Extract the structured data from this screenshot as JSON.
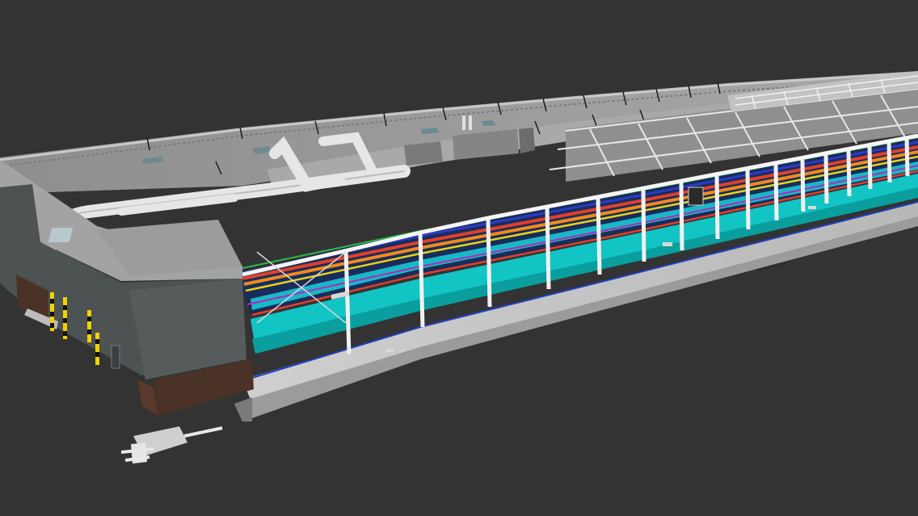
{
  "viewport": {
    "background": "#333333"
  },
  "scene": {
    "subject": "industrial-building-bim-model",
    "colors": {
      "roof": "#9a9a9a",
      "roof_light": "#b5b5b5",
      "parapet": "#8a8a8a",
      "wall_dark": "#4d5252",
      "wall_brick": "#4a3226",
      "floor": "#c9c9c9",
      "ground_shadow": "#2b2b2b",
      "pipe_white": "#e6e6e6",
      "duct_cyan": "#12c4c4",
      "duct_teal": "#0aa0a0",
      "pipe_red": "#e0402a",
      "pipe_orange": "#f08a1e",
      "pipe_yellow": "#e8d21a",
      "pipe_blue": "#2a3cc8",
      "pipe_magenta": "#b02ab8",
      "pipe_green": "#2ab84a",
      "column_white": "#f0f0f0",
      "bollard_yellow": "#f2d200",
      "bollard_black": "#111111"
    }
  }
}
